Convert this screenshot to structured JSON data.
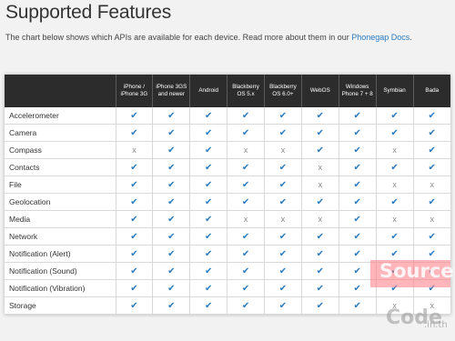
{
  "page": {
    "title": "Supported Features",
    "subtitle_text": "The chart below shows which APIs are available for each device. Read more about them in our ",
    "subtitle_link": "Phonegap Docs",
    "subtitle_end": "."
  },
  "columns": [
    "iPhone / iPhone 3G",
    "iPhone 3GS and newer",
    "Android",
    "Blackberry OS 5.x",
    "Blackberry OS 6.0+",
    "WebOS",
    "Windows Phone 7 + 8",
    "Symbian",
    "Bada"
  ],
  "symbols": {
    "yes": "✔",
    "no": "x"
  },
  "colors": {
    "check": "#2a7bbf",
    "link": "#2a7bbf",
    "header_bg": "#2c2c2c"
  },
  "rows": [
    {
      "feature": "Accelerometer",
      "support": [
        true,
        true,
        true,
        true,
        true,
        true,
        true,
        true,
        true
      ]
    },
    {
      "feature": "Camera",
      "support": [
        true,
        true,
        true,
        true,
        true,
        true,
        true,
        true,
        true
      ]
    },
    {
      "feature": "Compass",
      "support": [
        false,
        true,
        true,
        false,
        false,
        true,
        true,
        false,
        true
      ]
    },
    {
      "feature": "Contacts",
      "support": [
        true,
        true,
        true,
        true,
        true,
        false,
        true,
        true,
        true
      ]
    },
    {
      "feature": "File",
      "support": [
        true,
        true,
        true,
        true,
        true,
        false,
        true,
        false,
        false
      ]
    },
    {
      "feature": "Geolocation",
      "support": [
        true,
        true,
        true,
        true,
        true,
        true,
        true,
        true,
        true
      ]
    },
    {
      "feature": "Media",
      "support": [
        true,
        true,
        true,
        false,
        false,
        false,
        true,
        false,
        false
      ]
    },
    {
      "feature": "Network",
      "support": [
        true,
        true,
        true,
        true,
        true,
        true,
        true,
        true,
        true
      ]
    },
    {
      "feature": "Notification (Alert)",
      "support": [
        true,
        true,
        true,
        true,
        true,
        true,
        true,
        true,
        true
      ]
    },
    {
      "feature": "Notification (Sound)",
      "support": [
        true,
        true,
        true,
        true,
        true,
        true,
        true,
        true,
        true
      ]
    },
    {
      "feature": "Notification (Vibration)",
      "support": [
        true,
        true,
        true,
        true,
        true,
        true,
        true,
        true,
        true
      ]
    },
    {
      "feature": "Storage",
      "support": [
        true,
        true,
        true,
        true,
        true,
        true,
        true,
        false,
        false
      ]
    }
  ],
  "watermark": {
    "line1": "Source",
    "line2": "Code",
    "line3": ".in.th"
  }
}
